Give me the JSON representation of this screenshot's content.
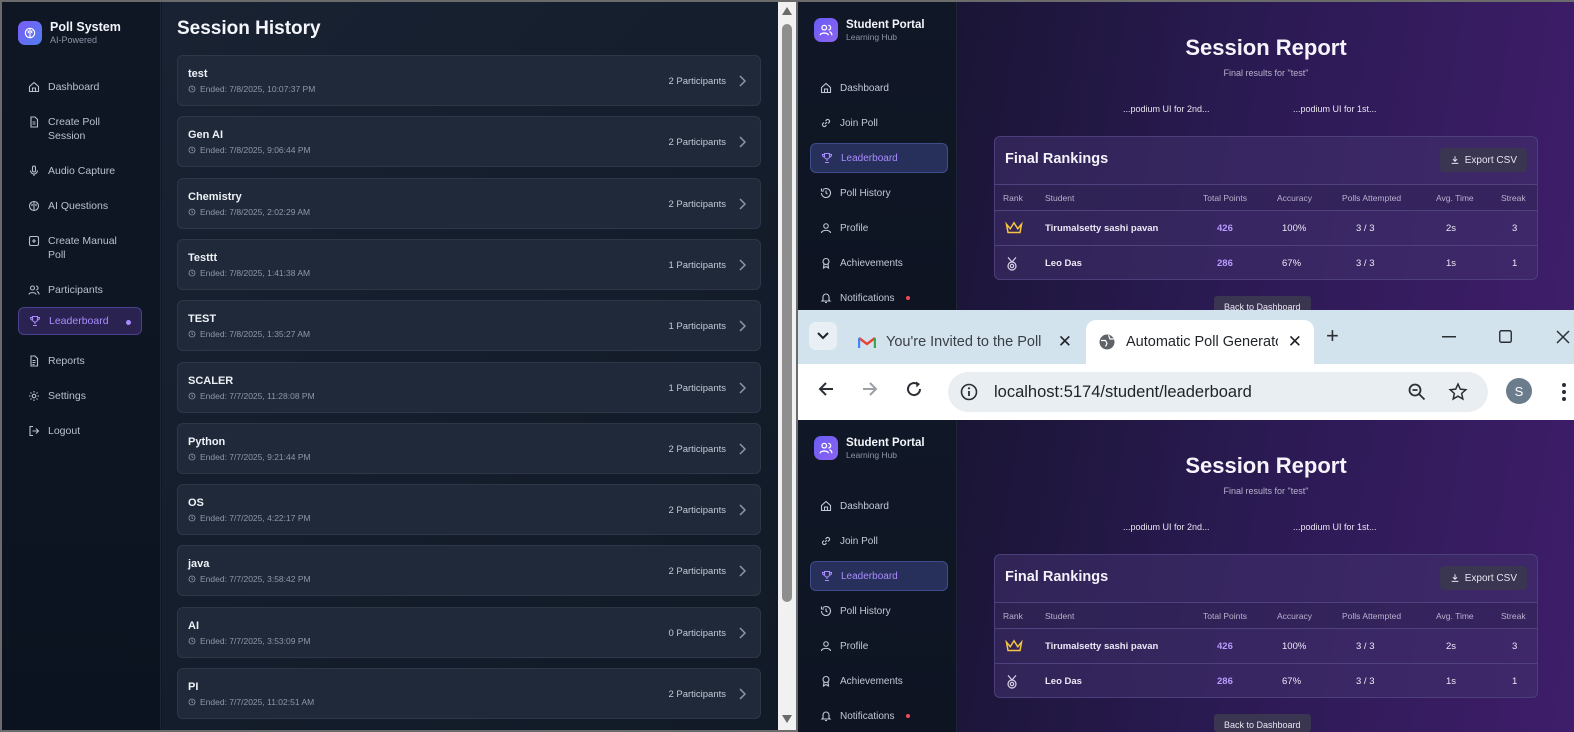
{
  "left_app": {
    "brand": {
      "title": "Poll System",
      "subtitle": "AI-Powered"
    },
    "nav": [
      {
        "label": "Dashboard",
        "icon": "home-icon"
      },
      {
        "label": "Create Poll Session",
        "icon": "document-icon"
      },
      {
        "label": "Audio Capture",
        "icon": "mic-icon"
      },
      {
        "label": "AI Questions",
        "icon": "brain-icon"
      },
      {
        "label": "Create Manual Poll",
        "icon": "plus-square-icon"
      },
      {
        "label": "Participants",
        "icon": "users-icon"
      },
      {
        "label": "Leaderboard",
        "icon": "trophy-icon",
        "active": true
      },
      {
        "label": "Reports",
        "icon": "report-icon"
      },
      {
        "label": "Settings",
        "icon": "gear-icon"
      },
      {
        "label": "Logout",
        "icon": "logout-icon"
      }
    ],
    "page_title": "Session History",
    "sessions": [
      {
        "name": "test",
        "ended": "Ended: 7/8/2025, 10:07:37 PM",
        "participants": "2 Participants"
      },
      {
        "name": "Gen AI",
        "ended": "Ended: 7/8/2025, 9:06:44 PM",
        "participants": "2 Participants"
      },
      {
        "name": "Chemistry",
        "ended": "Ended: 7/8/2025, 2:02:29 AM",
        "participants": "2 Participants"
      },
      {
        "name": "Testtt",
        "ended": "Ended: 7/8/2025, 1:41:38 AM",
        "participants": "1 Participants"
      },
      {
        "name": "TEST",
        "ended": "Ended: 7/8/2025, 1:35:27 AM",
        "participants": "1 Participants"
      },
      {
        "name": "SCALER",
        "ended": "Ended: 7/7/2025, 11:28:08 PM",
        "participants": "1 Participants"
      },
      {
        "name": "Python",
        "ended": "Ended: 7/7/2025, 9:21:44 PM",
        "participants": "2 Participants"
      },
      {
        "name": "OS",
        "ended": "Ended: 7/7/2025, 4:22:17 PM",
        "participants": "2 Participants"
      },
      {
        "name": "java",
        "ended": "Ended: 7/7/2025, 3:58:42 PM",
        "participants": "2 Participants"
      },
      {
        "name": "AI",
        "ended": "Ended: 7/7/2025, 3:53:09 PM",
        "participants": "0 Participants"
      },
      {
        "name": "PI",
        "ended": "Ended: 7/7/2025, 11:02:51 AM",
        "participants": "2 Participants"
      }
    ]
  },
  "portal": {
    "brand": {
      "title": "Student Portal",
      "subtitle": "Learning Hub"
    },
    "nav": [
      {
        "label": "Dashboard",
        "icon": "home-icon"
      },
      {
        "label": "Join Poll",
        "icon": "link-icon"
      },
      {
        "label": "Leaderboard",
        "icon": "trophy-icon",
        "active": true
      },
      {
        "label": "Poll History",
        "icon": "history-icon"
      },
      {
        "label": "Profile",
        "icon": "user-icon"
      },
      {
        "label": "Achievements",
        "icon": "award-icon"
      },
      {
        "label": "Notifications",
        "icon": "bell-icon",
        "dot": true
      }
    ],
    "report_title": "Session Report",
    "report_subtitle": "Final results for \"test\"",
    "podium_2nd": "...podium UI for 2nd...",
    "podium_1st": "...podium UI for 1st...",
    "rankings_title": "Final Rankings",
    "export_label": "Export CSV",
    "columns": [
      "Rank",
      "Student",
      "Total Points",
      "Accuracy",
      "Polls Attempted",
      "Avg. Time",
      "Streak"
    ],
    "rows": [
      {
        "rank_icon": "crown-icon",
        "student": "Tirumalsetty sashi pavan",
        "points": "426",
        "accuracy": "100%",
        "attempted": "3 / 3",
        "avg_time": "2s",
        "streak": "3"
      },
      {
        "rank_icon": "medal-icon",
        "student": "Leo Das",
        "points": "286",
        "accuracy": "67%",
        "attempted": "3 / 3",
        "avg_time": "1s",
        "streak": "1"
      }
    ],
    "back_label": "Back to Dashboard"
  },
  "browser": {
    "tabs": [
      {
        "title": "You're Invited to the Poll",
        "icon": "gmail-icon",
        "active": false
      },
      {
        "title": "Automatic Poll Generator",
        "icon": "globe-icon",
        "active": true
      }
    ],
    "url": "localhost:5174/student/leaderboard",
    "profile_initial": "S"
  },
  "colors": {
    "accent": "#a98bff",
    "points": "#b99bff",
    "notif_dot": "#f04b5a"
  }
}
